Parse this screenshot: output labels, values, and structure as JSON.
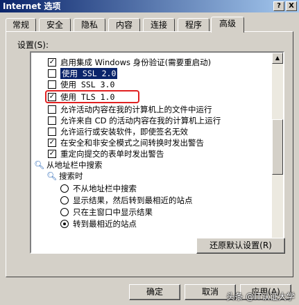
{
  "window": {
    "title": "Internet 选项",
    "help_label": "?",
    "close_label": "X"
  },
  "tabs": [
    "常规",
    "安全",
    "隐私",
    "内容",
    "连接",
    "程序",
    "高级"
  ],
  "active_tab": "高级",
  "settings_label": "设置(S):",
  "settings": [
    {
      "type": "checkbox",
      "checked": true,
      "label": "启用集成 Windows 身份验证(需要重启动)",
      "mono": false
    },
    {
      "type": "checkbox",
      "checked": false,
      "label": "使用 SSL 2.0",
      "mono": true,
      "selected": true
    },
    {
      "type": "checkbox",
      "checked": false,
      "label": "使用 SSL 3.0",
      "mono": true
    },
    {
      "type": "checkbox",
      "checked": true,
      "label": "使用 TLS 1.0",
      "mono": true,
      "highlighted": true
    },
    {
      "type": "checkbox",
      "checked": false,
      "label": "允许活动内容在我的计算机上的文件中运行",
      "mono": false
    },
    {
      "type": "checkbox",
      "checked": false,
      "label": "允许来自 CD 的活动内容在我的计算机上运行",
      "mono": false
    },
    {
      "type": "checkbox",
      "checked": false,
      "label": "允许运行或安装软件，即使签名无效",
      "mono": false
    },
    {
      "type": "checkbox",
      "checked": true,
      "label": "在安全和非安全模式之间转换时发出警告",
      "mono": false
    },
    {
      "type": "checkbox",
      "checked": true,
      "label": "重定向提交的表单时发出警告",
      "mono": false
    },
    {
      "type": "group",
      "icon": "magnifier-icon",
      "label": "从地址栏中搜索"
    },
    {
      "type": "subgroup",
      "icon": "magnifier-icon",
      "label": "搜索时"
    },
    {
      "type": "radio",
      "checked": false,
      "label": "不从地址栏中搜索"
    },
    {
      "type": "radio",
      "checked": false,
      "label": "显示结果，然后转到最相近的站点"
    },
    {
      "type": "radio",
      "checked": false,
      "label": "只在主窗口中显示结果"
    },
    {
      "type": "radio",
      "checked": true,
      "label": "转到最相近的站点"
    }
  ],
  "buttons": {
    "restore_defaults": "还原默认设置(R)",
    "ok": "确定",
    "cancel": "取消",
    "apply": "应用(A)"
  },
  "watermark": "头条 @IT认证大学"
}
